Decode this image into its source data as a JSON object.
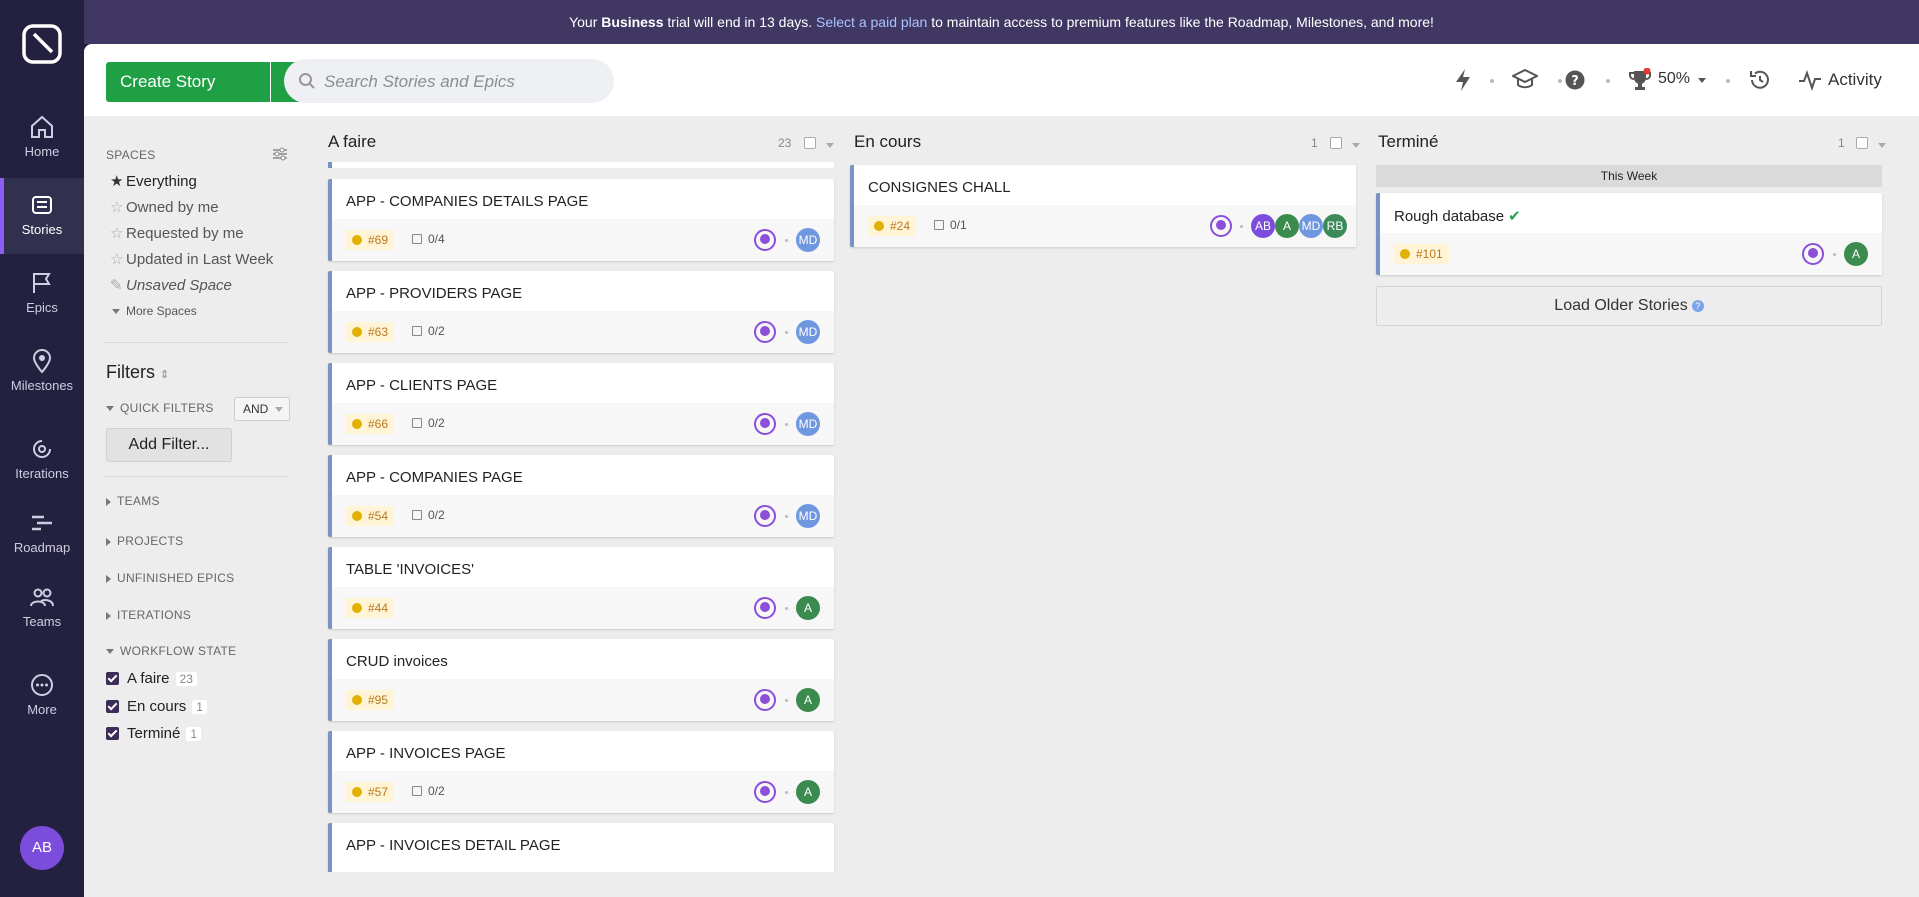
{
  "banner": {
    "prefix": "Your ",
    "plan": "Business",
    "mid": " trial will end in 13 days. ",
    "link": "Select a paid plan",
    "suffix": " to maintain access to premium features like the Roadmap, Milestones, and more!"
  },
  "nav": [
    {
      "label": "Home",
      "icon": "home-icon"
    },
    {
      "label": "Stories",
      "icon": "stories-icon",
      "active": true
    },
    {
      "label": "Epics",
      "icon": "epics-icon"
    },
    {
      "label": "Milestones",
      "icon": "milestones-icon"
    },
    {
      "label": "Iterations",
      "icon": "iterations-icon"
    },
    {
      "label": "Roadmap",
      "icon": "roadmap-icon"
    },
    {
      "label": "Teams",
      "icon": "teams-icon"
    },
    {
      "label": "More",
      "icon": "more-icon"
    }
  ],
  "user_avatar": "AB",
  "header": {
    "create_label": "Create Story",
    "search_placeholder": "Search Stories and Epics",
    "progress": "50%",
    "activity_label": "Activity"
  },
  "sidebar": {
    "spaces_label": "SPACES",
    "spaces": [
      "Everything",
      "Owned by me",
      "Requested by me",
      "Updated in Last Week",
      "Unsaved Space"
    ],
    "more_spaces": "More Spaces",
    "filters_title": "Filters",
    "quick_filters": "QUICK FILTERS",
    "and_label": "AND",
    "add_filter": "Add Filter...",
    "sections": [
      "TEAMS",
      "PROJECTS",
      "UNFINISHED EPICS",
      "ITERATIONS"
    ],
    "workflow_label": "WORKFLOW STATE",
    "workflow": [
      {
        "label": "A faire",
        "count": "23"
      },
      {
        "label": "En cours",
        "count": "1"
      },
      {
        "label": "Terminé",
        "count": "1"
      }
    ]
  },
  "columns": [
    {
      "title": "A faire",
      "count": "23",
      "cards": [
        {
          "title": "APP - COMPANIES DETAILS PAGE",
          "id": "#69",
          "tasks": "0/4",
          "owners": [
            "MD"
          ]
        },
        {
          "title": "APP - PROVIDERS PAGE",
          "id": "#63",
          "tasks": "0/2",
          "owners": [
            "MD"
          ]
        },
        {
          "title": "APP - CLIENTS PAGE",
          "id": "#66",
          "tasks": "0/2",
          "owners": [
            "MD"
          ]
        },
        {
          "title": "APP - COMPANIES PAGE",
          "id": "#54",
          "tasks": "0/2",
          "owners": [
            "MD"
          ]
        },
        {
          "title": "TABLE 'INVOICES'",
          "id": "#44",
          "tasks": "",
          "owners": [
            "A"
          ]
        },
        {
          "title": "CRUD invoices",
          "id": "#95",
          "tasks": "",
          "owners": [
            "A"
          ]
        },
        {
          "title": "APP - INVOICES PAGE",
          "id": "#57",
          "tasks": "0/2",
          "owners": [
            "A"
          ]
        },
        {
          "title": "APP - INVOICES DETAIL PAGE",
          "id": "",
          "tasks": "",
          "owners": []
        }
      ]
    },
    {
      "title": "En cours",
      "count": "1",
      "cards": [
        {
          "title": "CONSIGNES CHALL",
          "id": "#24",
          "tasks": "0/1",
          "owners": [
            "AB",
            "A",
            "MD",
            "RB"
          ]
        }
      ]
    },
    {
      "title": "Terminé",
      "count": "1",
      "week_label": "This Week",
      "cards": [
        {
          "title": "Rough database",
          "id": "#101",
          "tasks": "",
          "owners": [
            "A"
          ]
        }
      ],
      "load_older": "Load Older Stories"
    }
  ],
  "colors": {
    "accent": "#20a045",
    "nav_bg": "#23213f",
    "banner_bg": "#413763",
    "estimate": "#e0b100"
  }
}
